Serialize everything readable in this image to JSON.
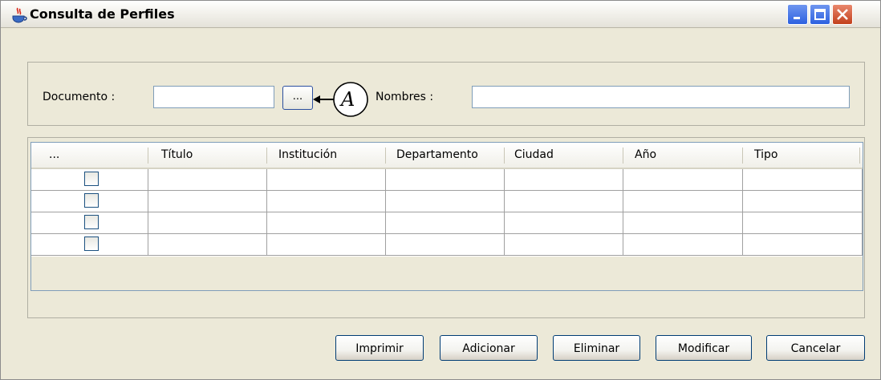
{
  "window": {
    "title": "Consulta de Perfiles",
    "icon": "java-cup-icon",
    "controls": [
      "minimize-icon",
      "maximize-icon",
      "close-icon"
    ],
    "accent_color": "#2d61e0",
    "close_color": "#c2401c"
  },
  "search": {
    "documento_label": "Documento :",
    "documento_value": "",
    "lookup_label": "...",
    "callout_letter": "A",
    "nombres_label": "Nombres :",
    "nombres_value": ""
  },
  "table": {
    "columns": [
      "...",
      "Título",
      "Institución",
      "Departamento",
      "Ciudad",
      "Año",
      "Tipo"
    ],
    "rows": [
      {
        "checked": false,
        "cells": [
          "",
          "",
          "",
          "",
          "",
          ""
        ]
      },
      {
        "checked": false,
        "cells": [
          "",
          "",
          "",
          "",
          "",
          ""
        ]
      },
      {
        "checked": false,
        "cells": [
          "",
          "",
          "",
          "",
          "",
          ""
        ]
      },
      {
        "checked": false,
        "cells": [
          "",
          "",
          "",
          "",
          "",
          ""
        ]
      }
    ]
  },
  "actions": {
    "imprimir": "Imprimir",
    "adicionar": "Adicionar",
    "eliminar": "Eliminar",
    "modificar": "Modificar",
    "cancelar": "Cancelar"
  }
}
